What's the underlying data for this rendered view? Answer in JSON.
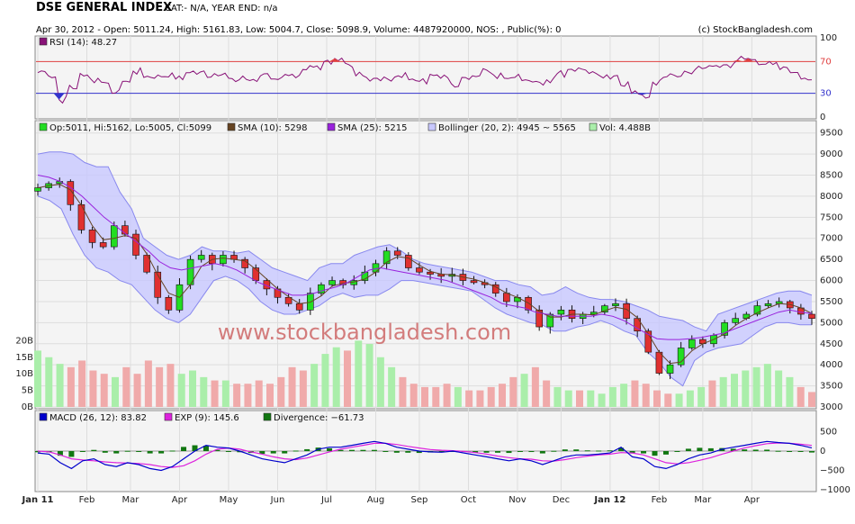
{
  "header": {
    "title": "DSE GENERAL INDEX",
    "title_suffix": "CAT:- N/A, YEAR END: n/a",
    "ohlc_line": "Apr 30, 2012 - Open: 5011.24, High: 5161.83, Low: 5004.7, Close: 5098.9, Volume: 4487920000, NOS: , Public(%): 0",
    "copyright": "(c) StockBangladesh.com"
  },
  "watermark": "www.stockbangladesh.com",
  "colors": {
    "up": "#22dd22",
    "down": "#e03030",
    "sma10": "#664422",
    "sma25": "#9922dd",
    "bollinger_fill": "#c8c8ff",
    "bollinger_line": "#8888ee",
    "vol_up": "#aaeeaa",
    "vol_down": "#f0aaaa",
    "rsi_line": "#881177",
    "rsi_overbought": "#e04040",
    "rsi_oversold": "#3333cc",
    "macd": "#0000cc",
    "exp": "#dd22dd",
    "divergence": "#117711",
    "grid": "#dddddd"
  },
  "chart_data": [
    {
      "type": "line",
      "panel": "rsi",
      "legend": "RSI (14): 48.27",
      "ylim": [
        0,
        100
      ],
      "y_ticks": [
        0,
        30,
        70,
        100
      ],
      "y_tick_labels": [
        "0",
        "30",
        "70",
        "100"
      ],
      "guides": [
        30,
        70
      ],
      "values_weekly": [
        56,
        52,
        22,
        40,
        55,
        48,
        44,
        30,
        45,
        58,
        50,
        49,
        51,
        48,
        56,
        54,
        50,
        52,
        49,
        47,
        46,
        52,
        48,
        50,
        54,
        60,
        63,
        70,
        74,
        68,
        52,
        50,
        49,
        48,
        52,
        47,
        45,
        54,
        49,
        42,
        50,
        52,
        61,
        53,
        49,
        50,
        47,
        45,
        47,
        55,
        60,
        62,
        55,
        52,
        48,
        40,
        30,
        28,
        44,
        50,
        53,
        58,
        60,
        62,
        65,
        66,
        72,
        74,
        66,
        70,
        60,
        56,
        48,
        47
      ],
      "last": 48.27
    },
    {
      "type": "line",
      "panel": "price",
      "ylim": [
        3000,
        9750
      ],
      "y_ticks": [
        3000,
        3500,
        4000,
        4500,
        5000,
        5500,
        6000,
        6500,
        7000,
        7500,
        8000,
        8500,
        9000,
        9500
      ],
      "y_tick_labels": [
        "3000",
        "3500",
        "4000",
        "4500",
        "5000",
        "5500",
        "6000",
        "6500",
        "7000",
        "7500",
        "8000",
        "8500",
        "9000",
        "9500"
      ],
      "x_tick_labels": [
        "Jan 11",
        "Feb",
        "Mar",
        "Apr",
        "May",
        "Jun",
        "Jul",
        "Aug",
        "Sep",
        "Oct",
        "Nov",
        "Dec",
        "Jan 12",
        "Feb",
        "Mar",
        "Apr"
      ],
      "x_tick_weeks": [
        0,
        4.5,
        8.5,
        13,
        17.5,
        22,
        26.5,
        31,
        35,
        39.5,
        44,
        48,
        52.5,
        57,
        61,
        65.5
      ],
      "legend": [
        {
          "key": "candles",
          "label": "Op:5011, Hi:5162, Lo:5005, Cl:5099"
        },
        {
          "key": "sma10",
          "label": "SMA (10): 5298"
        },
        {
          "key": "sma25",
          "label": "SMA (25): 5215"
        },
        {
          "key": "bollinger",
          "label": "Bollinger (20, 2): 4945 ~ 5565"
        },
        {
          "key": "volume",
          "label": "Vol: 4.488B"
        }
      ],
      "close_weekly": [
        8200,
        8300,
        8350,
        7800,
        7200,
        6900,
        6800,
        7300,
        7100,
        6600,
        6200,
        5600,
        5300,
        5900,
        6500,
        6600,
        6400,
        6600,
        6500,
        6300,
        6000,
        5800,
        5600,
        5450,
        5300,
        5700,
        5900,
        6000,
        5900,
        6000,
        6200,
        6400,
        6700,
        6600,
        6300,
        6200,
        6150,
        6100,
        6150,
        6000,
        5950,
        5900,
        5700,
        5500,
        5600,
        5300,
        4900,
        5200,
        5300,
        5100,
        5200,
        5250,
        5400,
        5450,
        5100,
        4800,
        4300,
        3800,
        4000,
        4400,
        4600,
        4500,
        4700,
        5000,
        5100,
        5200,
        5400,
        5450,
        5500,
        5350,
        5200,
        5100
      ],
      "sma25_weekly": [
        8500,
        8450,
        8350,
        8200,
        8000,
        7750,
        7500,
        7300,
        7100,
        6900,
        6700,
        6450,
        6300,
        6250,
        6300,
        6350,
        6400,
        6350,
        6250,
        6100,
        5950,
        5850,
        5750,
        5650,
        5650,
        5700,
        5780,
        5850,
        5950,
        6100,
        6250,
        6300,
        6250,
        6200,
        6150,
        6100,
        6050,
        6000,
        5900,
        5800,
        5700,
        5600,
        5450,
        5400,
        5350,
        5250,
        5200,
        5150,
        5150,
        5150,
        5150,
        5200,
        5150,
        5050,
        4900,
        4750,
        4620,
        4600,
        4600,
        4620,
        4650,
        4700,
        4750,
        4850,
        4950,
        5050,
        5150,
        5250,
        5300,
        5250,
        5220
      ],
      "bollinger_weekly": [
        [
          9000,
          8000
        ],
        [
          9050,
          7900
        ],
        [
          9050,
          7700
        ],
        [
          9000,
          7100
        ],
        [
          8800,
          6600
        ],
        [
          8700,
          6300
        ],
        [
          8700,
          6200
        ],
        [
          8100,
          6000
        ],
        [
          7700,
          5900
        ],
        [
          7000,
          5600
        ],
        [
          6800,
          5300
        ],
        [
          6600,
          5100
        ],
        [
          6500,
          5000
        ],
        [
          6600,
          5200
        ],
        [
          6800,
          5600
        ],
        [
          6700,
          6000
        ],
        [
          6700,
          6100
        ],
        [
          6650,
          6000
        ],
        [
          6700,
          5800
        ],
        [
          6500,
          5500
        ],
        [
          6300,
          5300
        ],
        [
          6200,
          5200
        ],
        [
          6100,
          5200
        ],
        [
          6000,
          5300
        ],
        [
          6300,
          5400
        ],
        [
          6400,
          5600
        ],
        [
          6400,
          5700
        ],
        [
          6600,
          5600
        ],
        [
          6700,
          5650
        ],
        [
          6800,
          5650
        ],
        [
          6850,
          5800
        ],
        [
          6700,
          6000
        ],
        [
          6500,
          6000
        ],
        [
          6400,
          5950
        ],
        [
          6350,
          5900
        ],
        [
          6300,
          5850
        ],
        [
          6250,
          5800
        ],
        [
          6200,
          5750
        ],
        [
          6100,
          5550
        ],
        [
          6000,
          5350
        ],
        [
          6000,
          5200
        ],
        [
          5900,
          5100
        ],
        [
          5850,
          5000
        ],
        [
          5650,
          4950
        ],
        [
          5700,
          4800
        ],
        [
          5850,
          4800
        ],
        [
          5700,
          4900
        ],
        [
          5600,
          4950
        ],
        [
          5550,
          5050
        ],
        [
          5550,
          4950
        ],
        [
          5500,
          4800
        ],
        [
          5400,
          4700
        ],
        [
          5300,
          4300
        ],
        [
          5150,
          4050
        ],
        [
          5100,
          3700
        ],
        [
          5050,
          3500
        ],
        [
          4900,
          4100
        ],
        [
          4800,
          4300
        ],
        [
          5200,
          4400
        ],
        [
          5300,
          4450
        ],
        [
          5400,
          4500
        ],
        [
          5500,
          4700
        ],
        [
          5600,
          4900
        ],
        [
          5700,
          5000
        ],
        [
          5750,
          5000
        ],
        [
          5750,
          4950
        ],
        [
          5650,
          4950
        ]
      ],
      "volume_axis": {
        "ylim": [
          0,
          22
        ],
        "ticks": [
          0,
          5,
          10,
          15,
          20
        ],
        "tick_labels": [
          "0B",
          "5B",
          "10B",
          "15B",
          "20B"
        ]
      },
      "volume_weekly_billions": [
        17,
        15,
        13,
        12,
        14,
        11,
        10,
        9,
        12,
        10,
        14,
        12,
        13,
        10,
        11,
        9,
        8,
        8,
        7,
        7,
        8,
        7,
        9,
        12,
        11,
        13,
        16,
        18,
        17,
        20,
        19,
        15,
        12,
        9,
        7,
        6,
        6,
        7,
        6,
        5,
        5,
        6,
        7,
        9,
        10,
        12,
        8,
        6,
        5,
        5,
        5,
        4,
        6,
        7,
        8,
        7,
        5,
        4,
        4,
        5,
        6,
        8,
        9,
        10,
        11,
        12,
        13,
        11,
        9,
        6,
        4.5
      ]
    },
    {
      "type": "line",
      "panel": "macd",
      "ylim": [
        -1000,
        1000
      ],
      "y_ticks": [
        -1000,
        -500,
        0,
        500
      ],
      "y_tick_labels": [
        "−1000",
        "−500",
        "0",
        "500"
      ],
      "legend": [
        {
          "key": "macd",
          "label": "MACD (26, 12): 83.82"
        },
        {
          "key": "exp",
          "label": "EXP (9): 145.6"
        },
        {
          "key": "divergence",
          "label": "Divergence: −61.73"
        }
      ],
      "macd_weekly": [
        -50,
        -80,
        -300,
        -450,
        -250,
        -200,
        -350,
        -400,
        -300,
        -350,
        -450,
        -500,
        -400,
        -200,
        0,
        150,
        100,
        80,
        0,
        -100,
        -200,
        -250,
        -300,
        -200,
        -100,
        50,
        100,
        100,
        150,
        200,
        250,
        200,
        100,
        50,
        0,
        -20,
        -30,
        0,
        -50,
        -100,
        -150,
        -200,
        -250,
        -200,
        -250,
        -350,
        -250,
        -150,
        -100,
        -100,
        -80,
        -50,
        100,
        -150,
        -200,
        -400,
        -450,
        -350,
        -200,
        -100,
        -50,
        50,
        100,
        150,
        200,
        250,
        220,
        200,
        150,
        84
      ],
      "exp_weekly": [
        0,
        -20,
        -100,
        -200,
        -230,
        -250,
        -280,
        -300,
        -310,
        -320,
        -350,
        -400,
        -420,
        -380,
        -250,
        -80,
        50,
        80,
        50,
        -20,
        -80,
        -150,
        -200,
        -220,
        -180,
        -100,
        -20,
        50,
        100,
        150,
        200,
        200,
        170,
        120,
        80,
        40,
        20,
        10,
        -10,
        -40,
        -80,
        -130,
        -170,
        -200,
        -210,
        -250,
        -260,
        -220,
        -170,
        -130,
        -100,
        -80,
        -40,
        -50,
        -100,
        -200,
        -300,
        -330,
        -300,
        -240,
        -170,
        -80,
        0,
        80,
        140,
        190,
        210,
        200,
        180,
        146
      ],
      "last": {
        "macd": 83.82,
        "exp": 145.6,
        "divergence": -61.73
      }
    }
  ]
}
